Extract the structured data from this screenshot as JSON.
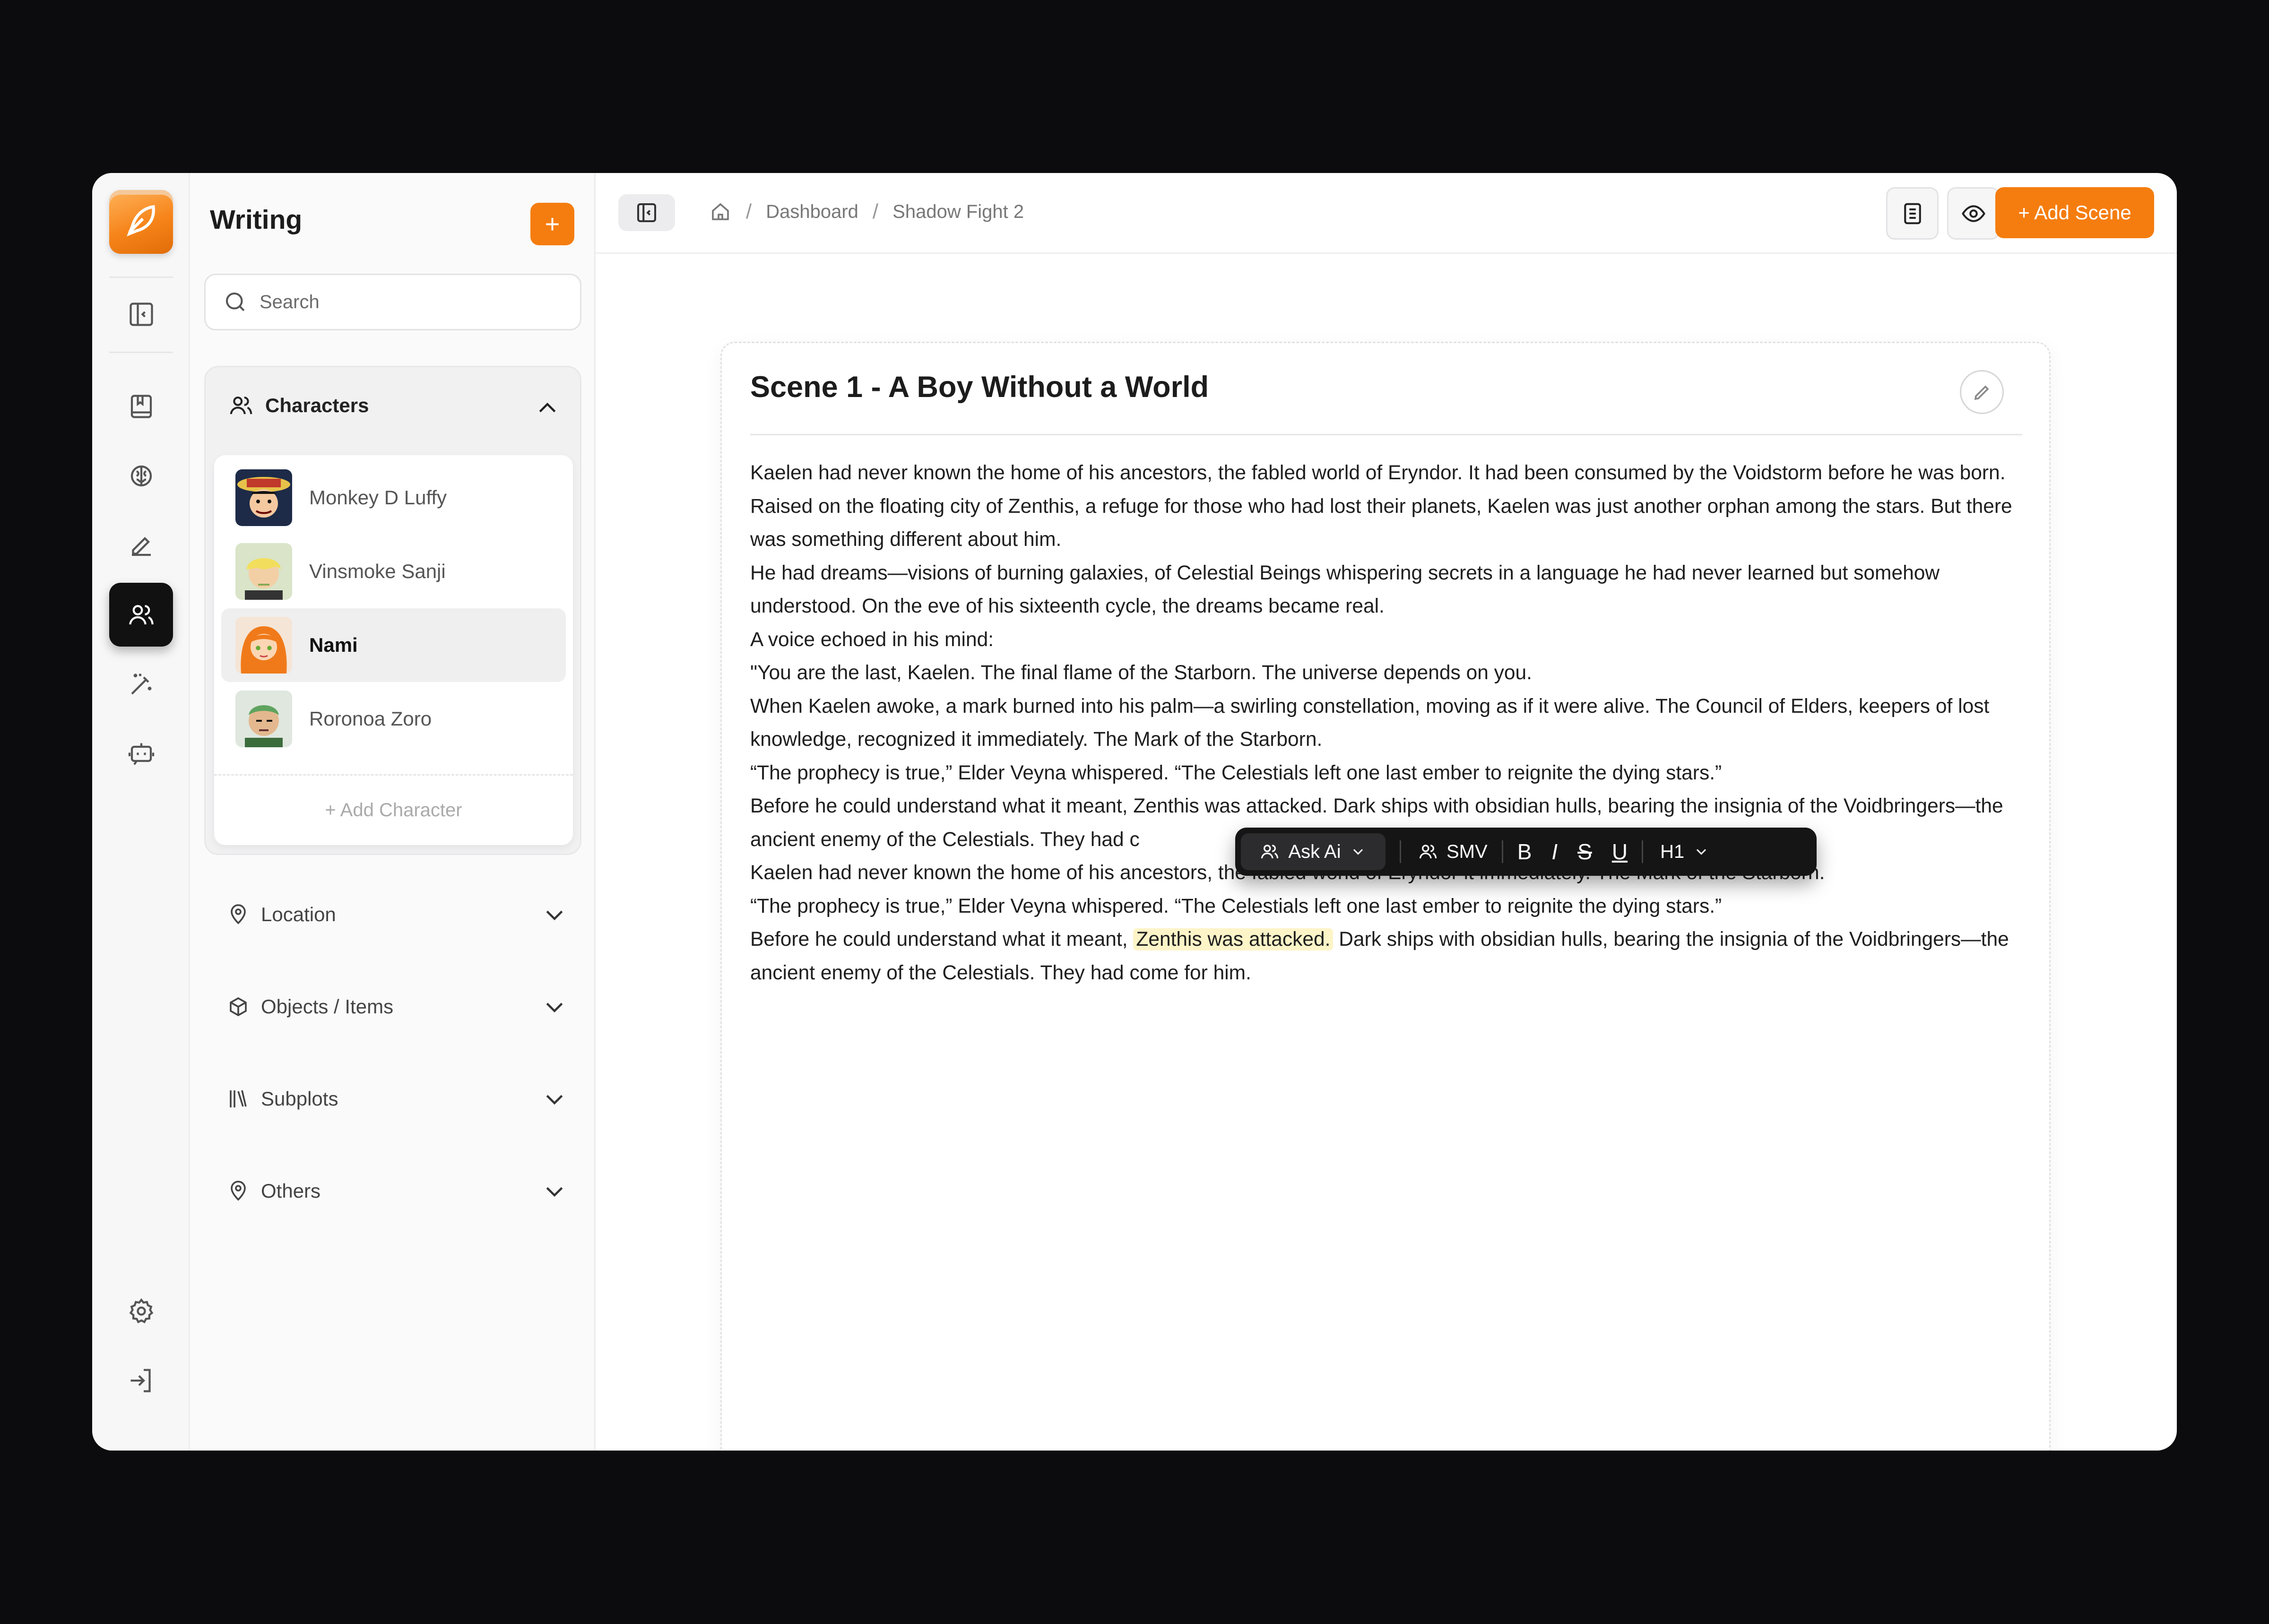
{
  "sidebar": {
    "title": "Writing",
    "add_label": "+",
    "search_placeholder": "Search",
    "characters": {
      "label": "Characters",
      "items": [
        {
          "name": "Monkey D Luffy"
        },
        {
          "name": "Vinsmoke Sanji"
        },
        {
          "name": "Nami"
        },
        {
          "name": "Roronoa Zoro"
        }
      ],
      "add_label": "+ Add Character"
    },
    "sections": [
      {
        "label": "Location"
      },
      {
        "label": "Objects / Items"
      },
      {
        "label": "Subplots"
      },
      {
        "label": "Others"
      }
    ]
  },
  "topbar": {
    "breadcrumb": [
      "Dashboard",
      "Shadow Fight 2"
    ],
    "add_scene_label": "+ Add Scene"
  },
  "editor": {
    "title": "Scene 1 - A Boy Without a World",
    "paragraphs": [
      "Kaelen had never known the home of his ancestors, the fabled world of Eryndor. It had been consumed by the Voidstorm before he was born. Raised on the floating city of Zenthis, a refuge for those who had lost their planets, Kaelen was just another orphan among the stars. But there was something different about him.",
      "He had dreams—visions of burning galaxies, of Celestial Beings whispering secrets in a language he had never learned but somehow understood. On the eve of his sixteenth cycle, the dreams became real.",
      "A voice echoed in his mind:",
      "\"You are the last, Kaelen. The final flame of the Starborn. The universe depends on you.",
      "When Kaelen awoke, a mark burned into his palm—a swirling constellation, moving as if it were alive. The Council of Elders, keepers of lost knowledge, recognized it immediately. The Mark of the Starborn.",
      "“The prophecy is true,” Elder Veyna whispered. “The Celestials left one last ember to reignite the dying stars.”",
      "Before he could understand what it meant, Zenthis was attacked. Dark ships with obsidian hulls, bearing the insignia of the Voidbringers—the ancient enemy of the Celestials. They had c",
      "Kaelen had never known the home of his ancestors, the fabled world of Eryndor it immediately. The Mark of the Starborn.",
      "“The prophecy is true,” Elder Veyna whispered. “The Celestials left one last ember to reignite the dying stars.”"
    ],
    "last_before": "Before he could understand what it meant, ",
    "last_highlight": "Zenthis was attacked.",
    "last_after": " Dark ships with obsidian hulls, bearing the insignia of the Voidbringers—the ancient enemy of the Celestials. They had come for him."
  },
  "toolbar": {
    "ask_ai": "Ask Ai",
    "smv": "SMV",
    "bold": "B",
    "italic": "I",
    "strike": "S",
    "underline": "U",
    "heading": "H1"
  },
  "colors": {
    "accent": "#f57d0f",
    "highlight": "#fdf4c8",
    "toolbar": "#151515"
  }
}
